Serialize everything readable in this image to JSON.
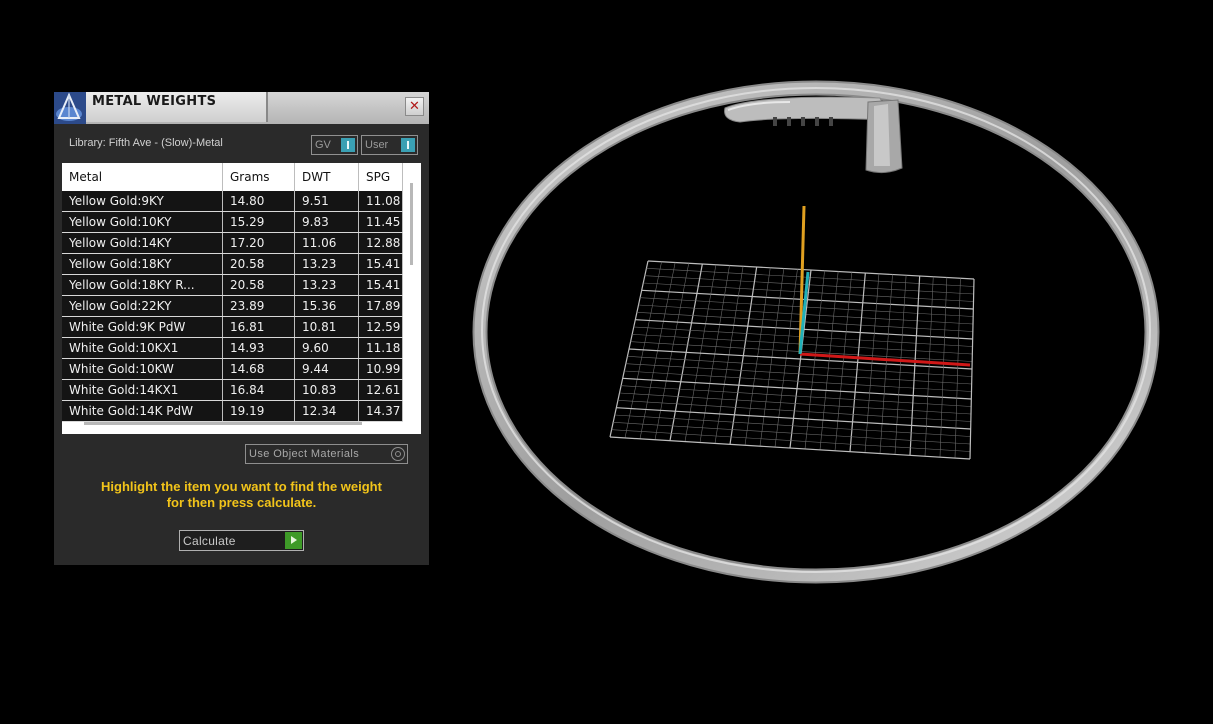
{
  "panel": {
    "title": "METAL WEIGHTS",
    "close_glyph": "✕",
    "library_label": "Library: Fifth Ave - (Slow)-Metal",
    "toggles": [
      {
        "label": "GV",
        "state": "on"
      },
      {
        "label": "User",
        "state": "on"
      }
    ],
    "table": {
      "headers": [
        "Metal",
        "Grams",
        "DWT",
        "SPG"
      ],
      "rows": [
        [
          "Yellow Gold:9KY",
          "14.80",
          "9.51",
          "11.08"
        ],
        [
          "Yellow Gold:10KY",
          "15.29",
          "9.83",
          "11.45"
        ],
        [
          "Yellow Gold:14KY",
          "17.20",
          "11.06",
          "12.88"
        ],
        [
          "Yellow Gold:18KY",
          "20.58",
          "13.23",
          "15.41"
        ],
        [
          "Yellow Gold:18KY R...",
          "20.58",
          "13.23",
          "15.41"
        ],
        [
          "Yellow Gold:22KY",
          "23.89",
          "15.36",
          "17.89"
        ],
        [
          "White Gold:9K PdW",
          "16.81",
          "10.81",
          "12.59"
        ],
        [
          "White Gold:10KX1",
          "14.93",
          "9.60",
          "11.18"
        ],
        [
          "White Gold:10KW",
          "14.68",
          "9.44",
          "10.99"
        ],
        [
          "White Gold:14KX1",
          "16.84",
          "10.83",
          "12.61"
        ],
        [
          "White Gold:14K PdW",
          "19.19",
          "12.34",
          "14.37"
        ]
      ]
    },
    "use_object_materials_label": "Use Object Materials",
    "hint_line1": "Highlight the item you want to find the weight",
    "hint_line2": "for then press calculate.",
    "calculate_label": "Calculate"
  },
  "colors": {
    "hint": "#f2c41a",
    "toggle_on": "#3aa0b4",
    "calculate_go": "#3e9a28",
    "axis_x": "#d01818",
    "axis_y": "#e0a020",
    "axis_z": "#20b0b8"
  },
  "icons": [
    "app-logo-icon",
    "close-icon",
    "toggle-knob-icon",
    "radio-icon",
    "play-arrow-icon"
  ]
}
